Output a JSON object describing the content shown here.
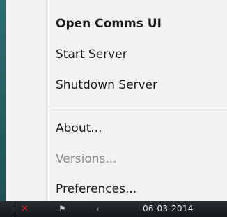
{
  "menu": {
    "items": [
      {
        "label": "Open Comms UI",
        "bold": true,
        "enabled": true
      },
      {
        "label": "Start Server",
        "bold": false,
        "enabled": true
      },
      {
        "label": "Shutdown Server",
        "bold": false,
        "enabled": true
      },
      {
        "label": "About...",
        "bold": false,
        "enabled": true
      },
      {
        "label": "Versions...",
        "bold": false,
        "enabled": false
      },
      {
        "label": "Preferences...",
        "bold": false,
        "enabled": true
      }
    ]
  },
  "taskbar": {
    "date_text": "06-03-2014",
    "icons": [
      "tray-app-icon",
      "flag-icon",
      "show-hidden-icons-arrow"
    ]
  },
  "colors": {
    "menu_background": "#f2f2f2",
    "disabled_text": "#8c8c8c",
    "taskbar": "#1e2226",
    "desktop": "#1e5a5e"
  }
}
